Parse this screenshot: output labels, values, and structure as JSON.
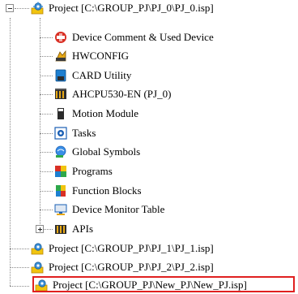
{
  "tree": {
    "root_project": {
      "label": "Project [C:\\GROUP_PJ\\PJ_0\\PJ_0.isp]",
      "expanded": true
    },
    "children": [
      {
        "label": "Device Comment & Used Device",
        "icon": "device-comment-icon"
      },
      {
        "label": "HWCONFIG",
        "icon": "hwconfig-icon"
      },
      {
        "label": "CARD Utility",
        "icon": "card-utility-icon"
      },
      {
        "label": "AHCPU530-EN  (PJ_0)",
        "icon": "cpu-module-icon"
      },
      {
        "label": "Motion Module",
        "icon": "motion-module-icon"
      },
      {
        "label": "Tasks",
        "icon": "tasks-icon"
      },
      {
        "label": "Global Symbols",
        "icon": "global-symbols-icon"
      },
      {
        "label": "Programs",
        "icon": "programs-icon"
      },
      {
        "label": "Function Blocks",
        "icon": "function-blocks-icon"
      },
      {
        "label": "Device Monitor Table",
        "icon": "device-monitor-table-icon"
      },
      {
        "label": "APIs",
        "icon": "apis-icon",
        "expandable": true
      }
    ],
    "other_projects": [
      {
        "label": "Project [C:\\GROUP_PJ\\PJ_1\\PJ_1.isp]"
      },
      {
        "label": "Project [C:\\GROUP_PJ\\PJ_2\\PJ_2.isp]"
      },
      {
        "label": "Project [C:\\GROUP_PJ\\New_PJ\\New_PJ.isp]",
        "highlighted": true
      }
    ],
    "highlight_color": "#e02020",
    "line_color": "#8a8a8a"
  }
}
